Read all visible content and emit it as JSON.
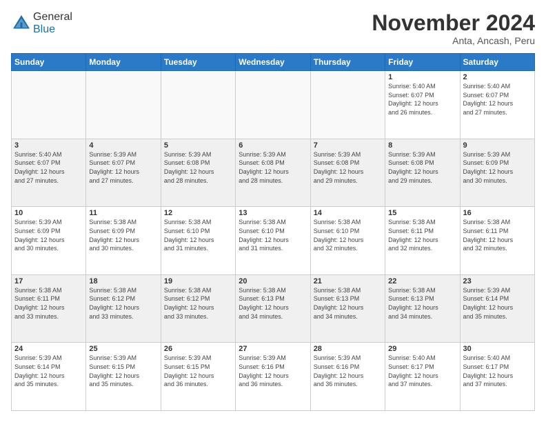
{
  "header": {
    "logo_general": "General",
    "logo_blue": "Blue",
    "month_title": "November 2024",
    "location": "Anta, Ancash, Peru"
  },
  "days_of_week": [
    "Sunday",
    "Monday",
    "Tuesday",
    "Wednesday",
    "Thursday",
    "Friday",
    "Saturday"
  ],
  "weeks": [
    [
      {
        "day": "",
        "info": ""
      },
      {
        "day": "",
        "info": ""
      },
      {
        "day": "",
        "info": ""
      },
      {
        "day": "",
        "info": ""
      },
      {
        "day": "",
        "info": ""
      },
      {
        "day": "1",
        "info": "Sunrise: 5:40 AM\nSunset: 6:07 PM\nDaylight: 12 hours\nand 26 minutes."
      },
      {
        "day": "2",
        "info": "Sunrise: 5:40 AM\nSunset: 6:07 PM\nDaylight: 12 hours\nand 27 minutes."
      }
    ],
    [
      {
        "day": "3",
        "info": "Sunrise: 5:40 AM\nSunset: 6:07 PM\nDaylight: 12 hours\nand 27 minutes."
      },
      {
        "day": "4",
        "info": "Sunrise: 5:39 AM\nSunset: 6:07 PM\nDaylight: 12 hours\nand 27 minutes."
      },
      {
        "day": "5",
        "info": "Sunrise: 5:39 AM\nSunset: 6:08 PM\nDaylight: 12 hours\nand 28 minutes."
      },
      {
        "day": "6",
        "info": "Sunrise: 5:39 AM\nSunset: 6:08 PM\nDaylight: 12 hours\nand 28 minutes."
      },
      {
        "day": "7",
        "info": "Sunrise: 5:39 AM\nSunset: 6:08 PM\nDaylight: 12 hours\nand 29 minutes."
      },
      {
        "day": "8",
        "info": "Sunrise: 5:39 AM\nSunset: 6:08 PM\nDaylight: 12 hours\nand 29 minutes."
      },
      {
        "day": "9",
        "info": "Sunrise: 5:39 AM\nSunset: 6:09 PM\nDaylight: 12 hours\nand 30 minutes."
      }
    ],
    [
      {
        "day": "10",
        "info": "Sunrise: 5:39 AM\nSunset: 6:09 PM\nDaylight: 12 hours\nand 30 minutes."
      },
      {
        "day": "11",
        "info": "Sunrise: 5:38 AM\nSunset: 6:09 PM\nDaylight: 12 hours\nand 30 minutes."
      },
      {
        "day": "12",
        "info": "Sunrise: 5:38 AM\nSunset: 6:10 PM\nDaylight: 12 hours\nand 31 minutes."
      },
      {
        "day": "13",
        "info": "Sunrise: 5:38 AM\nSunset: 6:10 PM\nDaylight: 12 hours\nand 31 minutes."
      },
      {
        "day": "14",
        "info": "Sunrise: 5:38 AM\nSunset: 6:10 PM\nDaylight: 12 hours\nand 32 minutes."
      },
      {
        "day": "15",
        "info": "Sunrise: 5:38 AM\nSunset: 6:11 PM\nDaylight: 12 hours\nand 32 minutes."
      },
      {
        "day": "16",
        "info": "Sunrise: 5:38 AM\nSunset: 6:11 PM\nDaylight: 12 hours\nand 32 minutes."
      }
    ],
    [
      {
        "day": "17",
        "info": "Sunrise: 5:38 AM\nSunset: 6:11 PM\nDaylight: 12 hours\nand 33 minutes."
      },
      {
        "day": "18",
        "info": "Sunrise: 5:38 AM\nSunset: 6:12 PM\nDaylight: 12 hours\nand 33 minutes."
      },
      {
        "day": "19",
        "info": "Sunrise: 5:38 AM\nSunset: 6:12 PM\nDaylight: 12 hours\nand 33 minutes."
      },
      {
        "day": "20",
        "info": "Sunrise: 5:38 AM\nSunset: 6:13 PM\nDaylight: 12 hours\nand 34 minutes."
      },
      {
        "day": "21",
        "info": "Sunrise: 5:38 AM\nSunset: 6:13 PM\nDaylight: 12 hours\nand 34 minutes."
      },
      {
        "day": "22",
        "info": "Sunrise: 5:38 AM\nSunset: 6:13 PM\nDaylight: 12 hours\nand 34 minutes."
      },
      {
        "day": "23",
        "info": "Sunrise: 5:39 AM\nSunset: 6:14 PM\nDaylight: 12 hours\nand 35 minutes."
      }
    ],
    [
      {
        "day": "24",
        "info": "Sunrise: 5:39 AM\nSunset: 6:14 PM\nDaylight: 12 hours\nand 35 minutes."
      },
      {
        "day": "25",
        "info": "Sunrise: 5:39 AM\nSunset: 6:15 PM\nDaylight: 12 hours\nand 35 minutes."
      },
      {
        "day": "26",
        "info": "Sunrise: 5:39 AM\nSunset: 6:15 PM\nDaylight: 12 hours\nand 36 minutes."
      },
      {
        "day": "27",
        "info": "Sunrise: 5:39 AM\nSunset: 6:16 PM\nDaylight: 12 hours\nand 36 minutes."
      },
      {
        "day": "28",
        "info": "Sunrise: 5:39 AM\nSunset: 6:16 PM\nDaylight: 12 hours\nand 36 minutes."
      },
      {
        "day": "29",
        "info": "Sunrise: 5:40 AM\nSunset: 6:17 PM\nDaylight: 12 hours\nand 37 minutes."
      },
      {
        "day": "30",
        "info": "Sunrise: 5:40 AM\nSunset: 6:17 PM\nDaylight: 12 hours\nand 37 minutes."
      }
    ]
  ]
}
